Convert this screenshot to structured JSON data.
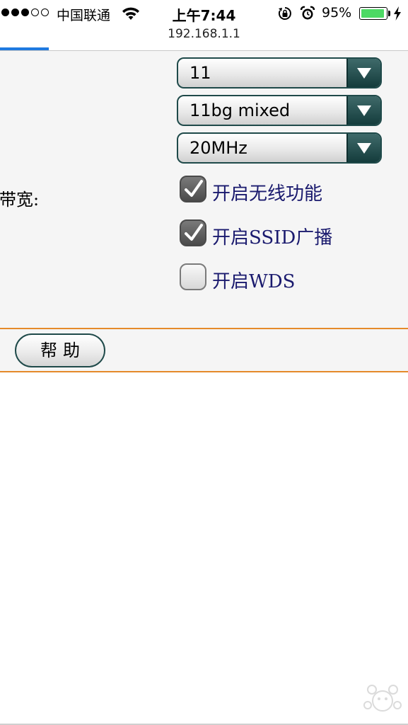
{
  "status_bar": {
    "carrier": "中国联通",
    "time": "上午7:44",
    "battery_percent": "95%",
    "signal_bars_filled": 3,
    "signal_bars_total": 5,
    "battery_level": 0.95,
    "icons": [
      "signal-dots-icon",
      "wifi-icon",
      "orientation-lock-icon",
      "alarm-icon",
      "battery-icon",
      "charging-bolt-icon"
    ]
  },
  "browser": {
    "url": "192.168.1.1",
    "load_progress": 0.12,
    "progress_color": "#1f7ae0"
  },
  "form": {
    "channel_select": {
      "value": "11"
    },
    "mode_select": {
      "value": "11bg mixed"
    },
    "bandwidth_label": "带宽:",
    "bandwidth_select": {
      "value": "20MHz"
    },
    "checkboxes": [
      {
        "label": "开启无线功能",
        "checked": true
      },
      {
        "label": "开启SSID广播",
        "checked": true
      },
      {
        "label": "开启WDS",
        "checked": false
      }
    ]
  },
  "help": {
    "button_label": "帮助"
  },
  "colors": {
    "accent_border": "#e58a2a",
    "select_arrow": "#1f4a4a",
    "label_text": "#1a1a6e"
  }
}
